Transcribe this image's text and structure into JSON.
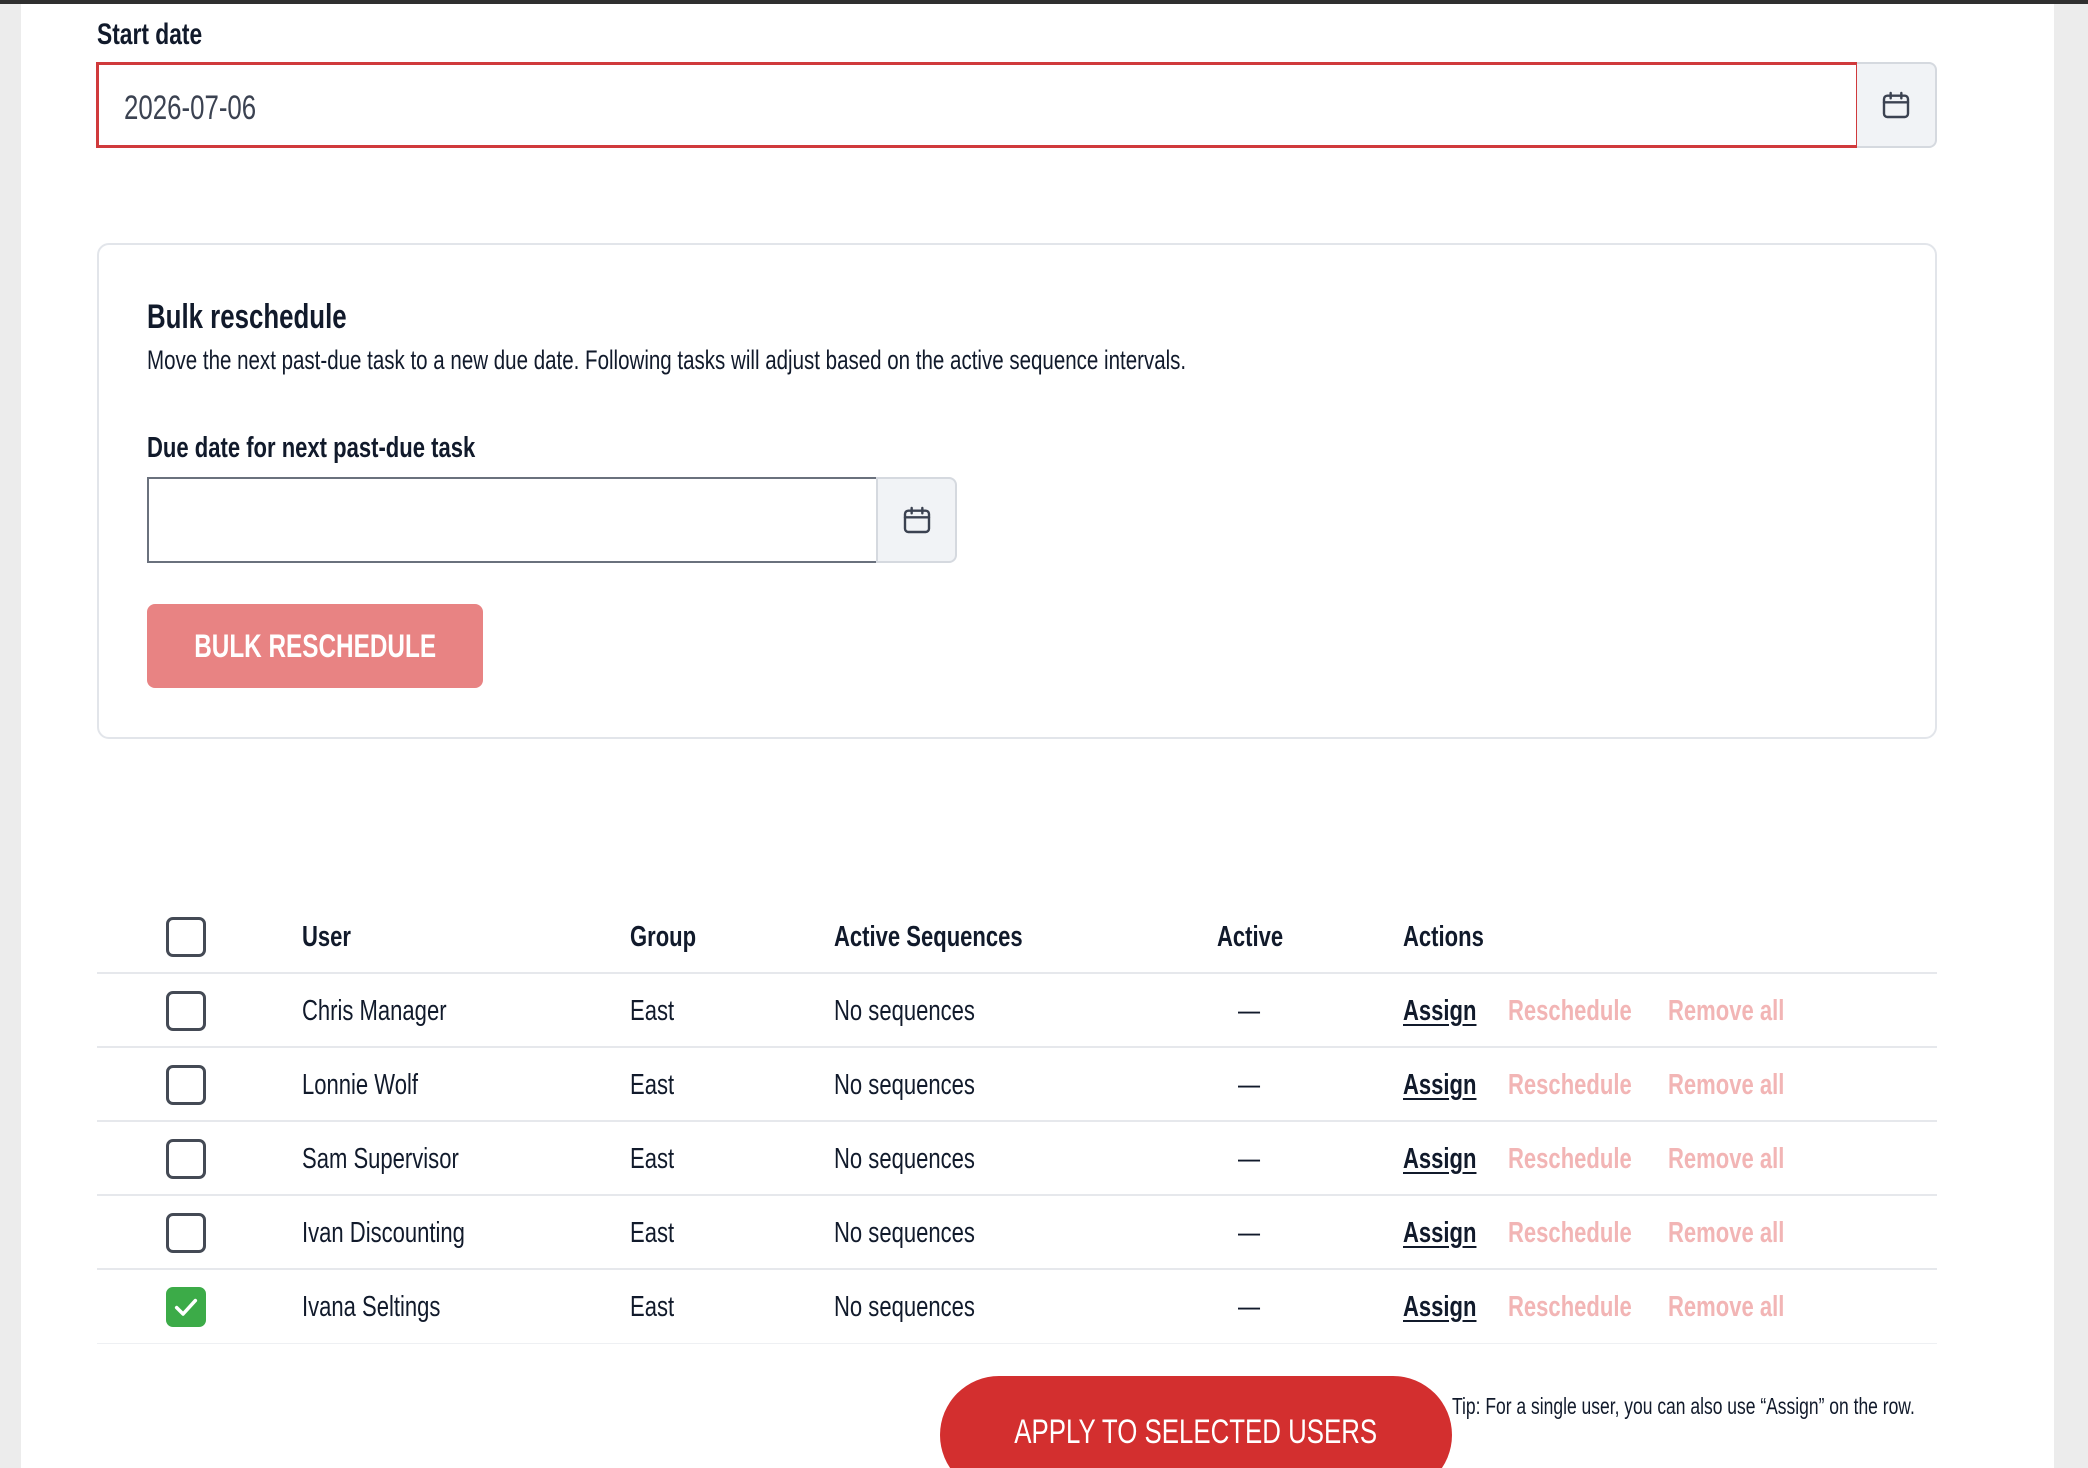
{
  "start_date": {
    "label": "Start date",
    "value": "2026-07-06"
  },
  "bulk": {
    "title": "Bulk reschedule",
    "description": "Move the next past-due task to a new due date. Following tasks will adjust based on the active sequence intervals.",
    "due_label": "Due date for next past-due task",
    "due_value": "",
    "button_label": "BULK RESCHEDULE"
  },
  "table": {
    "headers": {
      "user": "User",
      "group": "Group",
      "sequences": "Active Sequences",
      "active": "Active",
      "actions": "Actions"
    },
    "rows": [
      {
        "user": "Chris Manager",
        "group": "East",
        "sequences": "No sequences",
        "active": "—",
        "checked": false
      },
      {
        "user": "Lonnie Wolf",
        "group": "East",
        "sequences": "No sequences",
        "active": "—",
        "checked": false
      },
      {
        "user": "Sam Supervisor",
        "group": "East",
        "sequences": "No sequences",
        "active": "—",
        "checked": false
      },
      {
        "user": "Ivan Discounting",
        "group": "East",
        "sequences": "No sequences",
        "active": "—",
        "checked": false
      },
      {
        "user": "Ivana Seltings",
        "group": "East",
        "sequences": "No sequences",
        "active": "—",
        "checked": true
      }
    ],
    "actions": {
      "assign": "Assign",
      "reschedule": "Reschedule",
      "remove_all": "Remove all"
    }
  },
  "apply_button": "APPLY TO SELECTED USERS",
  "tip": "Tip: For a single user, you can also use “Assign” on the row.",
  "colors": {
    "primary": "#d32f2f",
    "primary_disabled": "#e88383",
    "link_disabled": "#f2b5b5",
    "checked": "#3cab48",
    "text": "#111a2b"
  },
  "icons": {
    "calendar": "calendar-icon",
    "check": "check-icon"
  }
}
